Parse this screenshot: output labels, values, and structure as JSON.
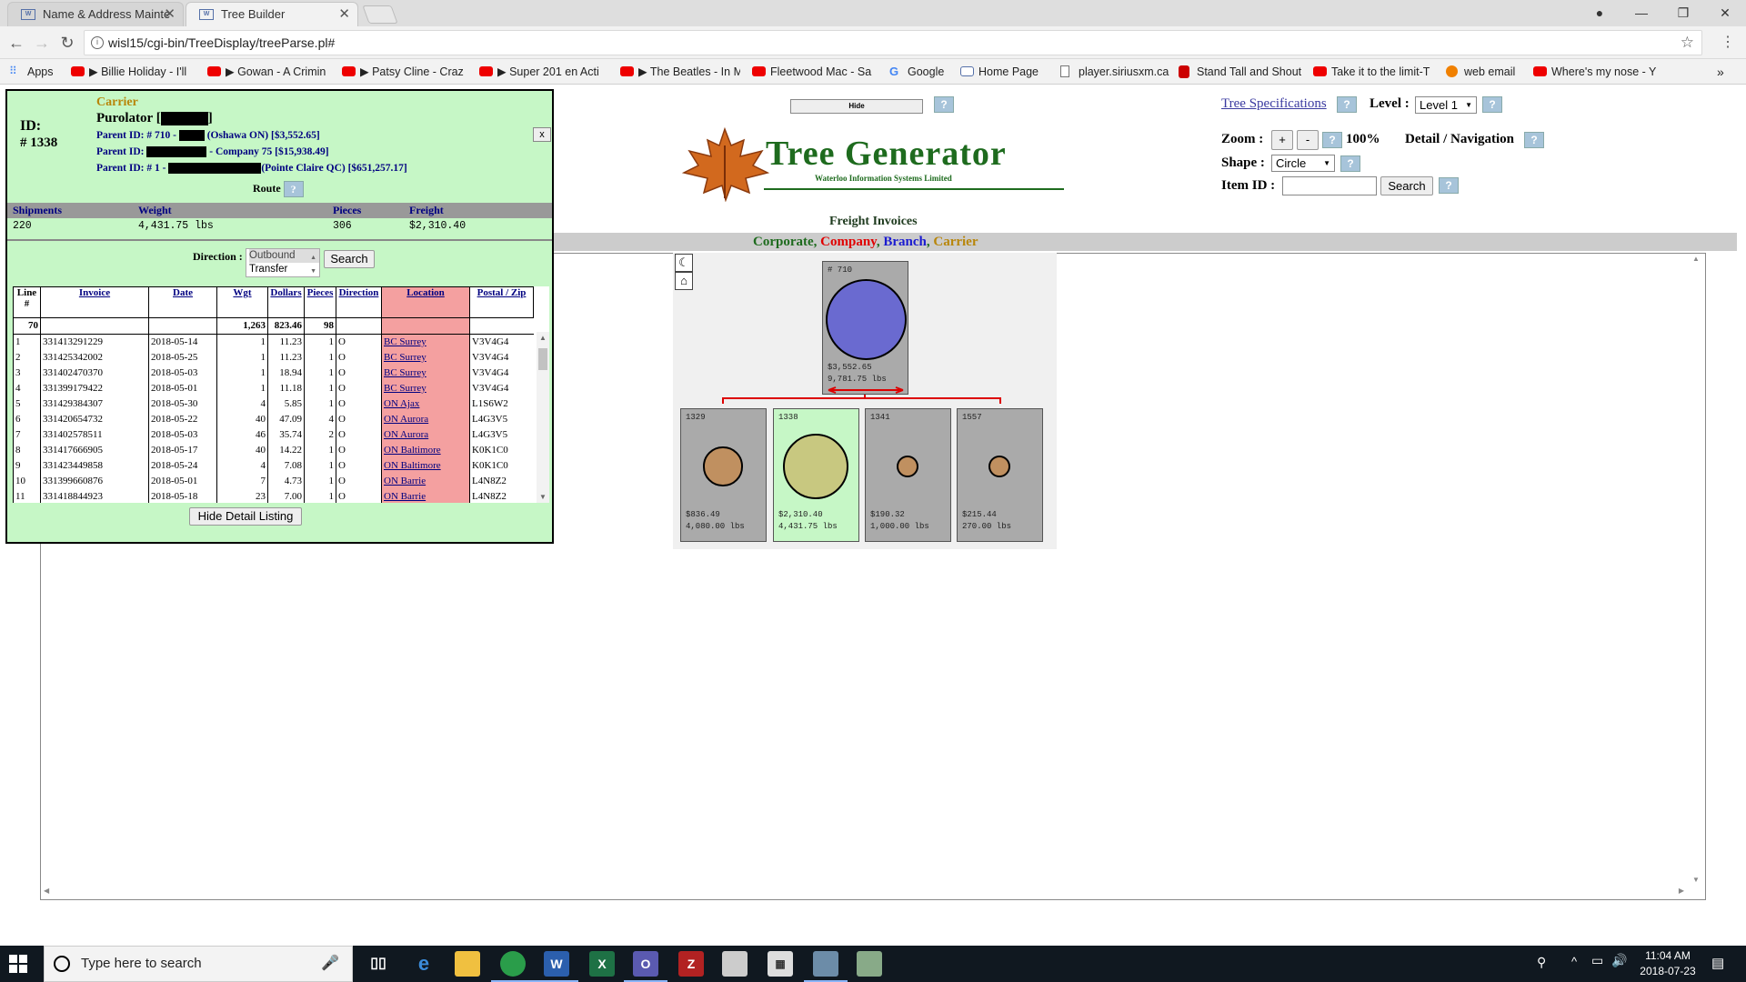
{
  "browser": {
    "tabs": [
      {
        "label": "Name & Address Mainte",
        "favicon": "W"
      },
      {
        "label": "Tree Builder",
        "favicon": "W"
      }
    ],
    "url": "wisl15/cgi-bin/TreeDisplay/treeParse.pl#",
    "bookmarks": [
      {
        "label": "Apps",
        "icon": "apps-grid-icon"
      },
      {
        "label": "▶ Billie Holiday - I'll",
        "icon": "youtube-icon"
      },
      {
        "label": "▶ Gowan - A Crimin",
        "icon": "youtube-icon"
      },
      {
        "label": "▶ Patsy Cline - Craz",
        "icon": "youtube-icon"
      },
      {
        "label": "▶ Super 201 en Acti",
        "icon": "youtube-icon"
      },
      {
        "label": "▶ The Beatles - In M",
        "icon": "youtube-icon"
      },
      {
        "label": "Fleetwood Mac - Sa",
        "icon": "youtube-icon"
      },
      {
        "label": "Google",
        "icon": "google-icon"
      },
      {
        "label": "Home Page",
        "icon": "wisl-icon"
      },
      {
        "label": "player.siriusxm.ca",
        "icon": "document-icon"
      },
      {
        "label": "Stand Tall and Shout",
        "icon": "sxm-icon"
      },
      {
        "label": "Take it to the limit-T",
        "icon": "youtube-icon"
      },
      {
        "label": "web email",
        "icon": "email-icon"
      },
      {
        "label": "Where's my nose - Y",
        "icon": "youtube-icon"
      }
    ]
  },
  "detail": {
    "type_label": "Carrier",
    "name": "Purolator [",
    "name_end": "]",
    "id_label": "ID:",
    "id_value": "# 1338",
    "parents": [
      {
        "prefix": "Parent ID: # 710 - ",
        "suffix": " (Oshawa ON) [$3,552.65]"
      },
      {
        "prefix": "Parent ID: ",
        "suffix": " - Company 75 [$15,938.49]"
      },
      {
        "prefix": "Parent ID: # 1 - ",
        "suffix": "(Pointe Claire QC) [$651,257.17]"
      }
    ],
    "route_label": "Route",
    "close_label": "x",
    "summary_headers": [
      "Shipments",
      "Weight",
      "Pieces",
      "Freight"
    ],
    "summary_values": [
      "220",
      "4,431.75 lbs",
      "306",
      "$2,310.40"
    ],
    "direction_label": "Direction :",
    "direction_options": [
      "Outbound",
      "Transfer"
    ],
    "search_label": "Search",
    "hide_detail_label": "Hide Detail Listing",
    "columns": [
      "Line #",
      "Invoice",
      "Date",
      "Wgt",
      "Dollars",
      "Pieces",
      "Direction",
      "Location",
      "Postal / Zip"
    ],
    "totals": {
      "line": "70",
      "wgt": "1,263",
      "dollars": "823.46",
      "pieces": "98"
    },
    "rows": [
      {
        "line": "1",
        "invoice": "331413291229",
        "date": "2018-05-14",
        "wgt": "1",
        "dollars": "11.23",
        "pieces": "1",
        "direction": "O",
        "location": "BC Surrey",
        "postal": "V3V4G4"
      },
      {
        "line": "2",
        "invoice": "331425342002",
        "date": "2018-05-25",
        "wgt": "1",
        "dollars": "11.23",
        "pieces": "1",
        "direction": "O",
        "location": "BC Surrey",
        "postal": "V3V4G4"
      },
      {
        "line": "3",
        "invoice": "331402470370",
        "date": "2018-05-03",
        "wgt": "1",
        "dollars": "18.94",
        "pieces": "1",
        "direction": "O",
        "location": "BC Surrey",
        "postal": "V3V4G4"
      },
      {
        "line": "4",
        "invoice": "331399179422",
        "date": "2018-05-01",
        "wgt": "1",
        "dollars": "11.18",
        "pieces": "1",
        "direction": "O",
        "location": "BC Surrey",
        "postal": "V3V4G4"
      },
      {
        "line": "5",
        "invoice": "331429384307",
        "date": "2018-05-30",
        "wgt": "4",
        "dollars": "5.85",
        "pieces": "1",
        "direction": "O",
        "location": "ON Ajax",
        "postal": "L1S6W2"
      },
      {
        "line": "6",
        "invoice": "331420654732",
        "date": "2018-05-22",
        "wgt": "40",
        "dollars": "47.09",
        "pieces": "4",
        "direction": "O",
        "location": "ON Aurora",
        "postal": "L4G3V5"
      },
      {
        "line": "7",
        "invoice": "331402578511",
        "date": "2018-05-03",
        "wgt": "46",
        "dollars": "35.74",
        "pieces": "2",
        "direction": "O",
        "location": "ON Aurora",
        "postal": "L4G3V5"
      },
      {
        "line": "8",
        "invoice": "331417666905",
        "date": "2018-05-17",
        "wgt": "40",
        "dollars": "14.22",
        "pieces": "1",
        "direction": "O",
        "location": "ON Baltimore",
        "postal": "K0K1C0"
      },
      {
        "line": "9",
        "invoice": "331423449858",
        "date": "2018-05-24",
        "wgt": "4",
        "dollars": "7.08",
        "pieces": "1",
        "direction": "O",
        "location": "ON Baltimore",
        "postal": "K0K1C0"
      },
      {
        "line": "10",
        "invoice": "331399660876",
        "date": "2018-05-01",
        "wgt": "7",
        "dollars": "4.73",
        "pieces": "1",
        "direction": "O",
        "location": "ON Barrie",
        "postal": "L4N8Z2"
      },
      {
        "line": "11",
        "invoice": "331418844923",
        "date": "2018-05-18",
        "wgt": "23",
        "dollars": "7.00",
        "pieces": "1",
        "direction": "O",
        "location": "ON Barrie",
        "postal": "L4N8Z2"
      }
    ]
  },
  "header": {
    "hide_label": "Hide",
    "logo_title": "Tree Generator",
    "logo_sub": "Waterloo Information Systems Limited",
    "report_title": "Freight Invoices",
    "legend": [
      {
        "label": "Corporate",
        "color": "#1e6b1e"
      },
      {
        "label": "Company",
        "color": "#e00000"
      },
      {
        "label": "Branch",
        "color": "#1a1ad0"
      },
      {
        "label": "Carrier",
        "color": "#b8860b"
      }
    ],
    "tree_spec_label": "Tree Specifications",
    "level_label": "Level :",
    "level_value": "Level 1",
    "zoom_label": "Zoom :",
    "zoom_plus": "+",
    "zoom_minus": "-",
    "zoom_value": "100%",
    "detail_nav_label": "Detail / Navigation",
    "shape_label": "Shape :",
    "shape_value": "Circle",
    "item_id_label": "Item ID :",
    "item_search_label": "Search"
  },
  "tree": {
    "root": {
      "id": "# 710",
      "value": "$3,552.65",
      "weight": "9,781.75 lbs",
      "color": "#6a6ad0"
    },
    "children": [
      {
        "id": "1329",
        "value": "$836.49",
        "weight": "4,080.00 lbs",
        "color": "#c09060",
        "selected": false
      },
      {
        "id": "1338",
        "value": "$2,310.40",
        "weight": "4,431.75 lbs",
        "color": "#c8c880",
        "selected": true
      },
      {
        "id": "1341",
        "value": "$190.32",
        "weight": "1,000.00 lbs",
        "color": "#c09060",
        "selected": false
      },
      {
        "id": "1557",
        "value": "$215.44",
        "weight": "270.00 lbs",
        "color": "#c09060",
        "selected": false
      }
    ]
  },
  "taskbar": {
    "search_placeholder": "Type here to search",
    "time": "11:04 AM",
    "date": "2018-07-23"
  }
}
